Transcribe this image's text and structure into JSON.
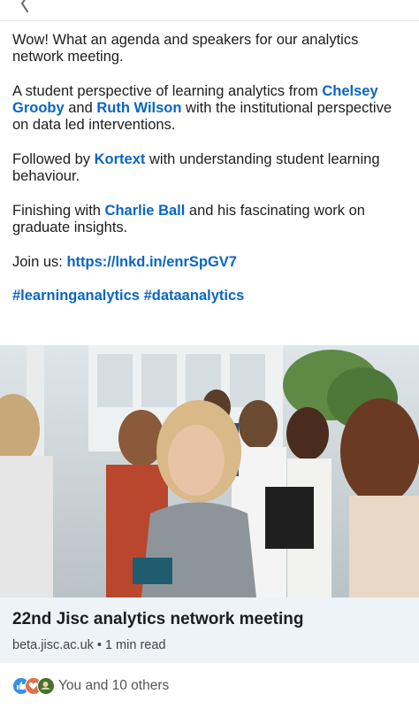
{
  "post": {
    "para1": "Wow! What an agenda and speakers for our analytics network meeting.",
    "para2_start": "A student perspective of learning analytics from ",
    "mention_chelsey": "Chelsey Grooby",
    "para2_and": " and ",
    "mention_ruth": "Ruth Wilson",
    "para2_end": " with the  institutional perspective on data led interventions.",
    "para3_start": "Followed by ",
    "mention_kortext": "Kortext",
    "para3_end": " with understanding student learning behaviour.",
    "para4_start": "Finishing with ",
    "mention_charlie": "Charlie Ball",
    "para4_end": " and his fascinating work on graduate insights.",
    "join_label": "Join us: ",
    "join_link": "https://lnkd.in/enrSpGV7",
    "hashtag1": "#learninganalytics",
    "hashtag_sep": " ",
    "hashtag2": "#dataanalytics"
  },
  "article": {
    "title": "22nd Jisc analytics network meeting",
    "domain": "beta.jisc.ac.uk",
    "separator": "•",
    "read_time": "1 min read"
  },
  "reactions": {
    "text": "You and 10 others",
    "icons": [
      "like-icon",
      "love-icon",
      "support-icon"
    ]
  },
  "colors": {
    "link": "#0a66c2",
    "card_bg": "#eef3f8",
    "like": "#378fe9",
    "love": "#df704d",
    "support": "#44712e"
  }
}
